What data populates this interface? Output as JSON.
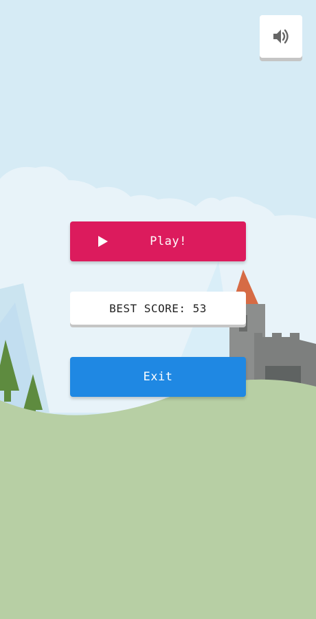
{
  "sound_button": {
    "icon": "speaker-volume-icon"
  },
  "menu": {
    "play_label": "Play!",
    "play_icon": "play-triangle-icon",
    "best_score_label": "BEST SCORE: 53",
    "exit_label": "Exit"
  },
  "colors": {
    "sky": "#d6ebf5",
    "clouds": "#e8f3f9",
    "mountains": "#cbe4f0",
    "hill": "#b7cfa4",
    "tree": "#5e8b3f",
    "castle_stone": "#8c8e8d",
    "castle_roof": "#d66b45",
    "play_button": "#dc1b5d",
    "exit_button": "#1f88e3",
    "score_panel": "#ffffff"
  }
}
